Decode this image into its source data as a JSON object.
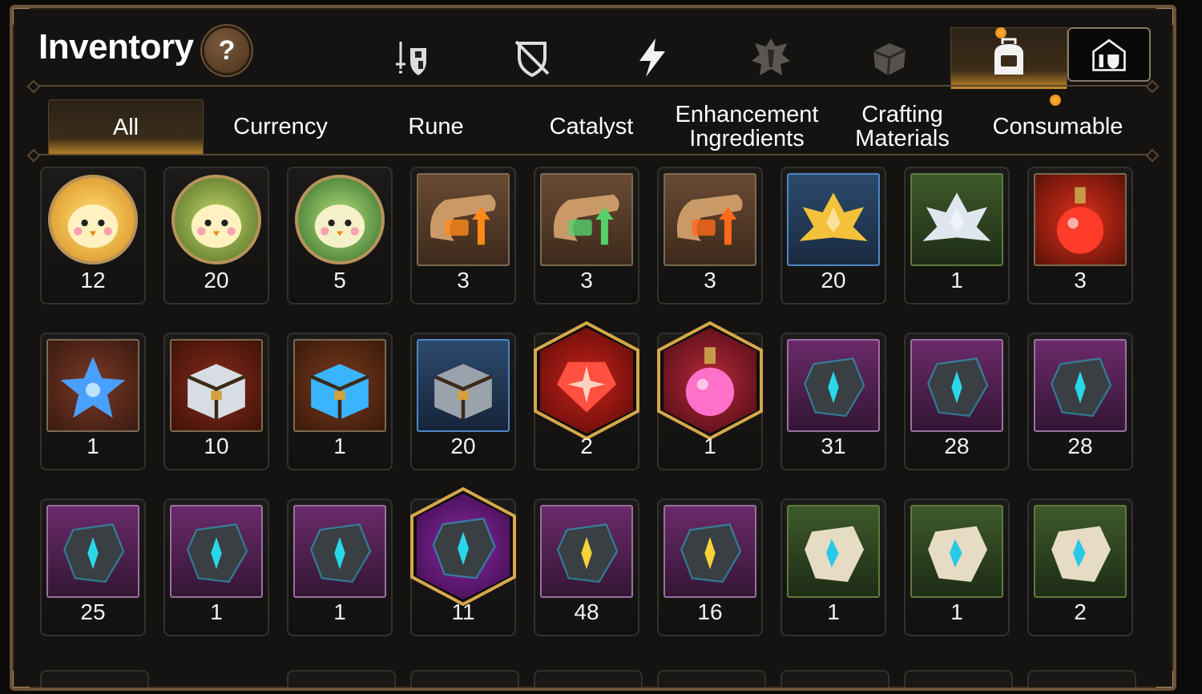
{
  "header": {
    "title": "Inventory",
    "help_label": "?"
  },
  "top_icons": [
    {
      "name": "equipment-sword-shield-icon",
      "active": false
    },
    {
      "name": "disabled-shield-icon",
      "active": false
    },
    {
      "name": "lightning-icon",
      "active": false
    },
    {
      "name": "crest-icon",
      "active": false
    },
    {
      "name": "cube-icon",
      "active": false
    },
    {
      "name": "backpack-icon",
      "active": true
    },
    {
      "name": "storage-house-icon",
      "active": false
    }
  ],
  "tabs": [
    {
      "label": "All",
      "active": true
    },
    {
      "label": "Currency",
      "active": false
    },
    {
      "label": "Rune",
      "active": false
    },
    {
      "label": "Catalyst",
      "active": false
    },
    {
      "label": "Enhancement\nIngredients",
      "active": false
    },
    {
      "label": "Crafting\nMaterials",
      "active": false
    },
    {
      "label": "Consumable",
      "active": false
    }
  ],
  "colors": {
    "accent_gold": "#c68a2a",
    "notification_dot": "#f59a1f",
    "frame_brown": "#6a5338"
  },
  "items": [
    {
      "icon": "gold-chick-coin-icon",
      "count": "12"
    },
    {
      "icon": "green-chick-coin-icon",
      "count": "20"
    },
    {
      "icon": "leaf-chick-coin-icon",
      "count": "5"
    },
    {
      "icon": "scroll-upgrade-orange-icon",
      "count": "3"
    },
    {
      "icon": "scroll-upgrade-rainbow-icon",
      "count": "3"
    },
    {
      "icon": "scroll-upgrade-red-icon",
      "count": "3"
    },
    {
      "icon": "gold-lotus-crystal-icon",
      "count": "20"
    },
    {
      "icon": "silver-lotus-crystal-icon",
      "count": "1"
    },
    {
      "icon": "red-potion-icon",
      "count": "3"
    },
    {
      "icon": "star-potion-icon",
      "count": "1"
    },
    {
      "icon": "silver-gold-chest-icon",
      "count": "10"
    },
    {
      "icon": "blue-glow-chest-icon",
      "count": "1"
    },
    {
      "icon": "iron-chest-icon",
      "count": "20"
    },
    {
      "icon": "red-star-gem-icon",
      "count": "2"
    },
    {
      "icon": "pink-potion-icon",
      "count": "1"
    },
    {
      "icon": "rune-sword-icon",
      "count": "31"
    },
    {
      "icon": "rune-helmet-icon",
      "count": "28"
    },
    {
      "icon": "rune-armor-icon",
      "count": "28"
    },
    {
      "icon": "rune-boots-icon",
      "count": "25"
    },
    {
      "icon": "rune-ring-icon",
      "count": "1"
    },
    {
      "icon": "rune-necklace-icon",
      "count": "1"
    },
    {
      "icon": "rune-star-icon",
      "count": "11"
    },
    {
      "icon": "rune-hammer-gold-icon",
      "count": "48"
    },
    {
      "icon": "rune-blade-gold-icon",
      "count": "16"
    },
    {
      "icon": "stone-rune-sword-icon",
      "count": "1"
    },
    {
      "icon": "stone-rune-helmet-icon",
      "count": "1"
    },
    {
      "icon": "stone-rune-armor-icon",
      "count": "2"
    }
  ]
}
